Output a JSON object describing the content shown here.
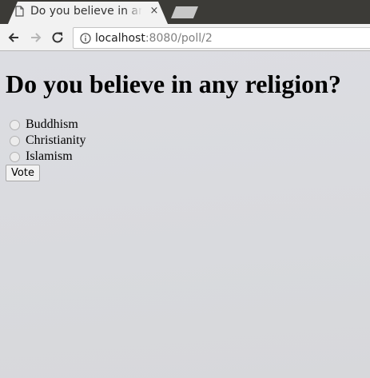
{
  "browser": {
    "tab_title": "Do you believe in any religion?",
    "tab_close": "×",
    "url_host": "localhost",
    "url_path": ":8080/poll/2"
  },
  "poll": {
    "question": "Do you believe in any religion?",
    "options": [
      {
        "label": "Buddhism",
        "selected": false
      },
      {
        "label": "Christianity",
        "selected": false
      },
      {
        "label": "Islamism",
        "selected": false
      }
    ],
    "vote_label": "Vote"
  },
  "icons": {
    "favicon": "page-icon",
    "close": "close-icon",
    "back": "back-arrow-icon",
    "forward": "forward-arrow-icon",
    "reload": "reload-icon",
    "info": "info-icon"
  },
  "colors": {
    "titlebar": "#3c3b37",
    "toolbar": "#f2f2f2",
    "page_background": "#dcdde1"
  }
}
